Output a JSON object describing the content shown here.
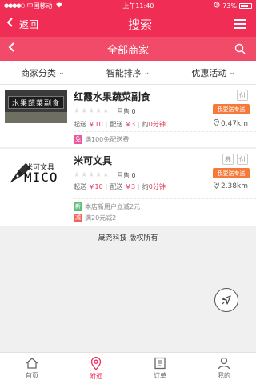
{
  "status": {
    "carrier": "中国移动",
    "time": "上午11:40",
    "battery_text": "73%",
    "battery_level": 0.73
  },
  "nav": {
    "back_label": "返回",
    "title": "搜索"
  },
  "subbar": {
    "title": "全部商家"
  },
  "filters": [
    {
      "label": "商家分类"
    },
    {
      "label": "智能排序"
    },
    {
      "label": "优惠活动"
    }
  ],
  "shops": [
    {
      "name": "红霞水果蔬菜副食",
      "logo_text": "水果蔬菜副食",
      "tags": [
        "付"
      ],
      "monthly_sales": "月售 0",
      "promo_badge": "我要送专送",
      "min_order_label": "起送",
      "min_order": "￥10",
      "delivery_label": "配送",
      "delivery_fee": "￥3",
      "time_label": "约",
      "time_value": "0分钟",
      "distance": "0.47km",
      "rating": 0,
      "activities": [
        {
          "icon": "免",
          "text": "满100免配送费",
          "color": "#e85aa0"
        }
      ]
    },
    {
      "name": "米可文具",
      "logo_text_top": "米可文具",
      "logo_text_bottom": "MICO",
      "tags": [
        "券",
        "付"
      ],
      "monthly_sales": "月售 0",
      "promo_badge": "我要送专送",
      "min_order_label": "起送",
      "min_order": "￥10",
      "delivery_label": "配送",
      "delivery_fee": "￥3",
      "time_label": "约",
      "time_value": "0分钟",
      "distance": "2.38km",
      "rating": 0,
      "activities": [
        {
          "icon": "新",
          "text": "本店新用户立减2元",
          "color": "#5fbf7f"
        },
        {
          "icon": "减",
          "text": "满20元减2",
          "color": "#f0645a"
        }
      ]
    }
  ],
  "footer": {
    "copyright": "晟尧科技 版权所有"
  },
  "tabbar": [
    {
      "label": "首页",
      "icon": "home-icon",
      "active": false
    },
    {
      "label": "附近",
      "icon": "location-pin-icon",
      "active": true
    },
    {
      "label": "订单",
      "icon": "order-list-icon",
      "active": false
    },
    {
      "label": "我的",
      "icon": "user-icon",
      "active": false
    }
  ],
  "colors": {
    "brand": "#f02d54",
    "subbar": "#f24b6a",
    "promo": "#f57a3a"
  }
}
